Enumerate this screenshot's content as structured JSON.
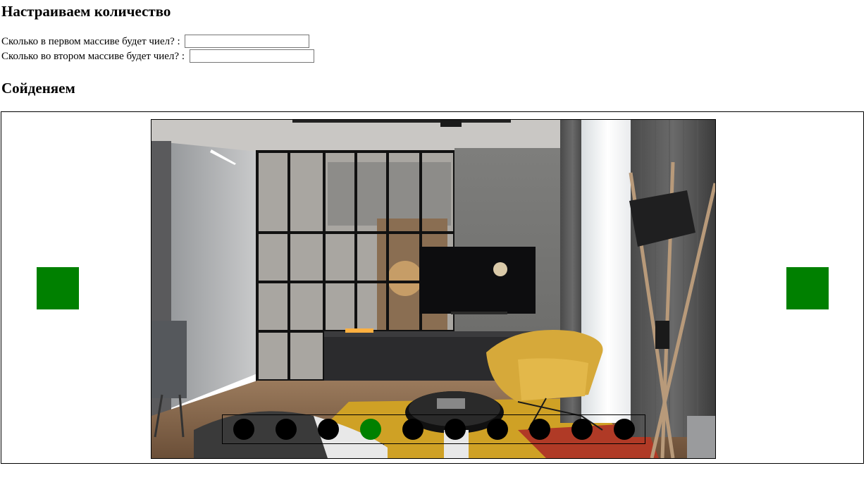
{
  "headings": {
    "quantity": "Настраиваем количество",
    "connect": "Сойденяем"
  },
  "form": {
    "first_label": "Сколько в первом массиве будет чиел? :",
    "first_value": "",
    "second_label": "Сколько во втором массиве будет чиел? :",
    "second_value": ""
  },
  "slider": {
    "arrow_color": "#008000",
    "dot_color": "#000000",
    "active_dot_color": "#008000",
    "dot_count": 10,
    "active_dot_index": 3,
    "slide_image": "interior-living-room-photo"
  }
}
